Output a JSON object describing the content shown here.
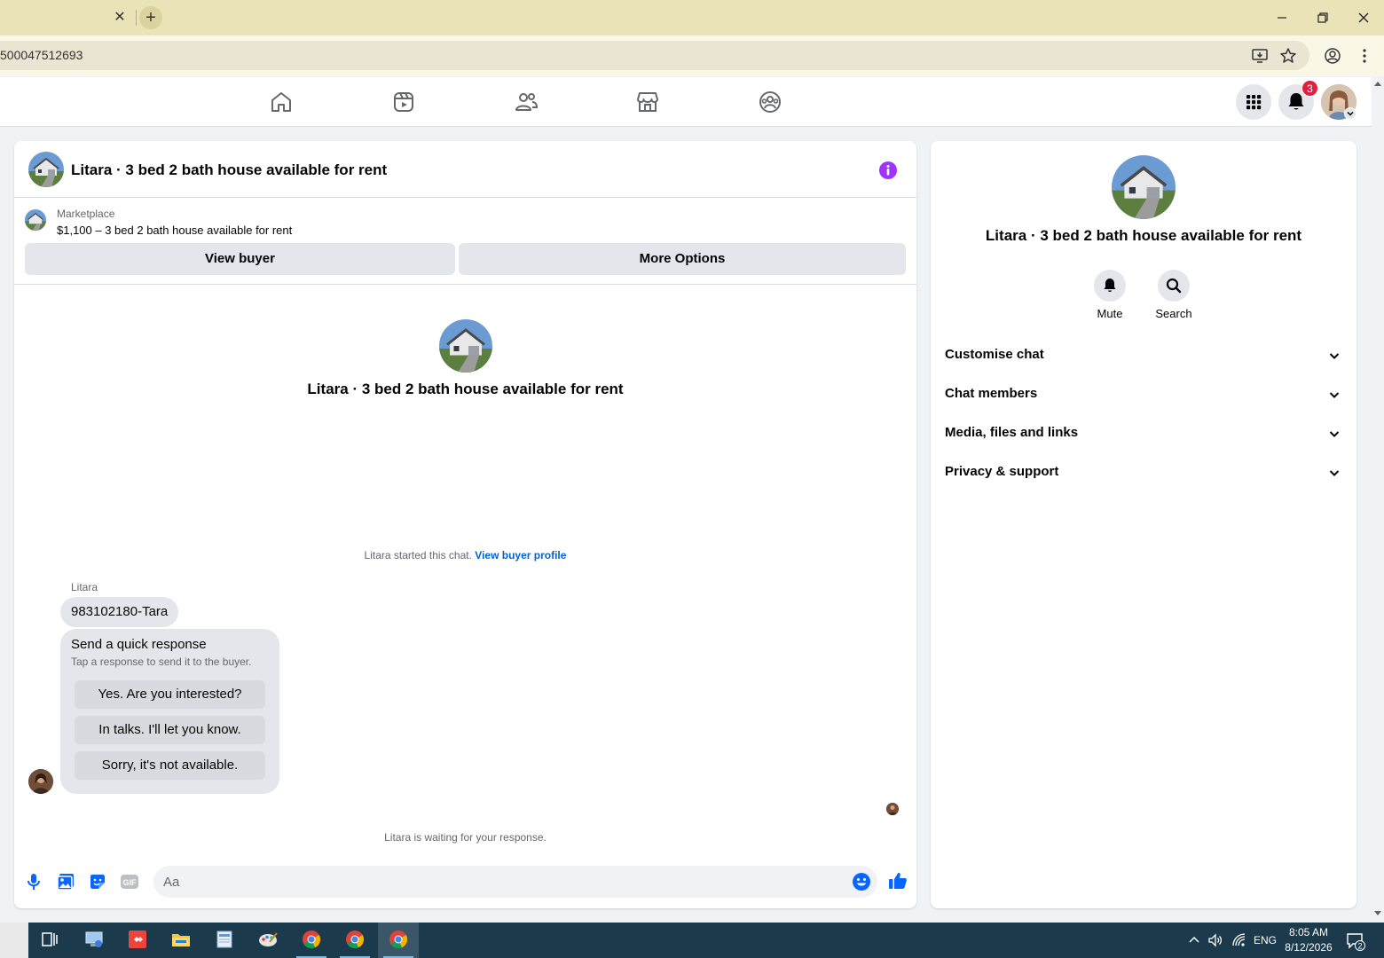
{
  "browser": {
    "url": "500047512693",
    "tab_close": "✕",
    "new_tab": "+",
    "window_controls": [
      "minimize-icon",
      "restore-icon",
      "close-icon"
    ]
  },
  "header": {
    "nav_icons": [
      "home-icon",
      "video-icon",
      "friends-icon",
      "marketplace-icon",
      "groups-icon"
    ],
    "notification_count": "3"
  },
  "chat": {
    "title": "Litara · 3 bed 2 bath house available for rent",
    "marketplace_label": "Marketplace",
    "listing": "$1,100 – 3 bed 2 bath house available for rent",
    "view_buyer": "View buyer",
    "more_options": "More Options",
    "center_title": "Litara · 3 bed 2 bath house available for rent",
    "started_text": "Litara started this chat.",
    "view_buyer_profile": "View buyer profile",
    "sender_name": "Litara",
    "message": "983102180-Tara",
    "quick_response": {
      "title": "Send a quick response",
      "subtitle": "Tap a response to send it to the buyer.",
      "options": [
        "Yes. Are you interested?",
        "In talks. I'll let you know.",
        "Sorry, it's not available."
      ]
    },
    "waiting": "Litara is waiting for your response.",
    "composer_placeholder": "Aa",
    "gif_label": "GIF"
  },
  "info_panel": {
    "title": "Litara · 3 bed 2 bath house available for rent",
    "actions": [
      {
        "label": "Mute",
        "icon": "bell-icon"
      },
      {
        "label": "Search",
        "icon": "search-icon"
      }
    ],
    "sections": [
      "Customise chat",
      "Chat members",
      "Media, files and links",
      "Privacy & support"
    ]
  },
  "taskbar": {
    "language": "ENG",
    "time": "8:05 AM",
    "date": "8/12/2026",
    "notifications": "2"
  },
  "colors": {
    "accent_blue": "#0866ff",
    "info_purple": "#a033ff",
    "badge_red": "#e41e3f",
    "tabbar": "#ebe3b8"
  }
}
